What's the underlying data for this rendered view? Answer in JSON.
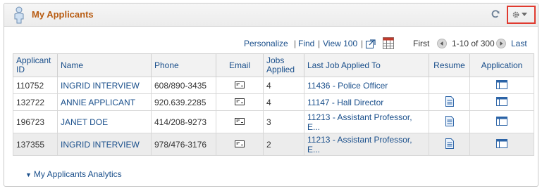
{
  "pagelet": {
    "title": "My Applicants",
    "person_icon": "person-icon",
    "refresh_icon": "refresh-icon",
    "settings_icon": "gear-dropdown-icon"
  },
  "toolbar": {
    "personalize": "Personalize",
    "sep1": "|",
    "find": "Find",
    "sep2": "|",
    "view": "View 100",
    "sep3": "|",
    "first": "First",
    "range": "1-10 of 300",
    "last": "Last"
  },
  "table": {
    "headers": {
      "applicant_id": "Applicant ID",
      "name": "Name",
      "phone": "Phone",
      "email": "Email",
      "jobs": "Jobs Applied",
      "last_job": "Last Job Applied To",
      "resume": "Resume",
      "application": "Application"
    },
    "rows": [
      {
        "id": "110752",
        "name": "INGRID INTERVIEW",
        "phone": "608/890-3435",
        "jobs": "4",
        "last_job": "11436 - Police Officer",
        "has_resume": false
      },
      {
        "id": "132722",
        "name": "ANNIE APPLICANT",
        "phone": "920.639.2285",
        "jobs": "4",
        "last_job": "11147 - Hall Director",
        "has_resume": true
      },
      {
        "id": "196723",
        "name": "JANET DOE",
        "phone": "414/208-9273",
        "jobs": "3",
        "last_job": "11213 - Assistant Professor, E...",
        "has_resume": true
      },
      {
        "id": "137355",
        "name": "INGRID INTERVIEW",
        "phone": "978/476-3176",
        "jobs": "2",
        "last_job": "11213 - Assistant Professor, E...",
        "has_resume": true
      }
    ]
  },
  "analytics": {
    "label": "My Applicants Analytics"
  }
}
